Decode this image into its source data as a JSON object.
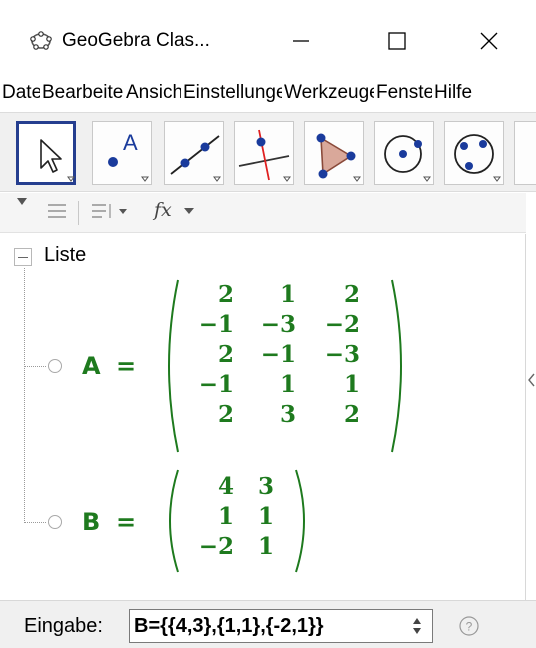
{
  "window": {
    "title": "GeoGebra Clas...",
    "minimize_glyph": "—",
    "maximize_glyph": "☐",
    "close_glyph": "✕"
  },
  "menu": {
    "items": [
      {
        "label": "Datei"
      },
      {
        "label": "Bearbeiten"
      },
      {
        "label": "Ansicht"
      },
      {
        "label": "Einstellungen"
      },
      {
        "label": "Werkzeuge"
      },
      {
        "label": "Fenster"
      },
      {
        "label": "Hilfe"
      }
    ]
  },
  "toolbar": {
    "tools": [
      {
        "name": "move-tool",
        "icon": "arrow-cursor-icon",
        "selected": true
      },
      {
        "name": "point-tool",
        "icon": "point-icon",
        "letter": "A"
      },
      {
        "name": "line-tool",
        "icon": "line-through-points-icon"
      },
      {
        "name": "perpendicular-tool",
        "icon": "perpendicular-line-icon"
      },
      {
        "name": "polygon-tool",
        "icon": "polygon-icon"
      },
      {
        "name": "circle-tool",
        "icon": "circle-center-point-icon"
      },
      {
        "name": "circle-three-points-tool",
        "icon": "circle-three-points-icon"
      }
    ]
  },
  "algebra_header": {
    "fx_label": "fx"
  },
  "algebra": {
    "group_label": "Liste",
    "objects": [
      {
        "name": "A",
        "eq": "=",
        "rows": [
          [
            "2",
            "1",
            "2"
          ],
          [
            "−1",
            "−3",
            "−2"
          ],
          [
            "2",
            "−1",
            "−3"
          ],
          [
            "−1",
            "1",
            "1"
          ],
          [
            "2",
            "3",
            "2"
          ]
        ]
      },
      {
        "name": "B",
        "eq": "=",
        "rows": [
          [
            "4",
            "3"
          ],
          [
            "1",
            "1"
          ],
          [
            "−2",
            "1"
          ]
        ]
      }
    ]
  },
  "input_bar": {
    "label": "Eingabe:",
    "value": "B={{4,3},{1,1},{-2,1}}",
    "help_glyph": "?"
  },
  "colors": {
    "matrix_green": "#1e7a1e",
    "selected_tool_border": "#253e8f",
    "polygon_fill": "#d9a89a",
    "point_blue": "#1a3b9c",
    "perp_red": "#e02020"
  }
}
